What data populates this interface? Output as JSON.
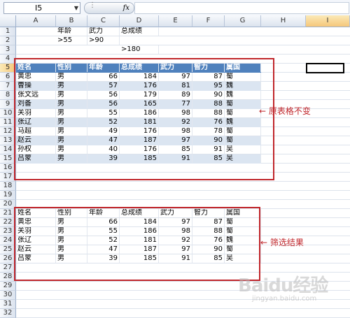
{
  "formula_bar": {
    "name_box": "I5",
    "fx_label": "fx",
    "formula": ""
  },
  "columns": [
    "A",
    "B",
    "C",
    "D",
    "E",
    "F",
    "G",
    "H",
    "I"
  ],
  "active_column": "I",
  "active_row": "5",
  "rows": [
    "1",
    "2",
    "3",
    "4",
    "5",
    "6",
    "7",
    "8",
    "9",
    "10",
    "11",
    "12",
    "13",
    "14",
    "15",
    "16",
    "17",
    "18",
    "19",
    "20",
    "21",
    "22",
    "23",
    "24",
    "25",
    "26",
    "27",
    "28",
    "29",
    "30",
    "31",
    "32"
  ],
  "criteria": {
    "row1": [
      "",
      "年龄",
      "武力",
      "总成绩"
    ],
    "row2": [
      "",
      ">55",
      ">90",
      ""
    ],
    "row3": [
      "",
      "",
      "",
      ">180"
    ]
  },
  "table_headers": [
    "姓名",
    "性别",
    "年龄",
    "总成绩",
    "武力",
    "智力",
    "属国"
  ],
  "table_rows": [
    [
      "黄忠",
      "男",
      "66",
      "184",
      "97",
      "87",
      "蜀"
    ],
    [
      "曹操",
      "男",
      "57",
      "176",
      "81",
      "95",
      "魏"
    ],
    [
      "张文远",
      "男",
      "56",
      "179",
      "89",
      "90",
      "魏"
    ],
    [
      "刘备",
      "男",
      "56",
      "165",
      "77",
      "88",
      "蜀"
    ],
    [
      "关羽",
      "男",
      "55",
      "186",
      "98",
      "88",
      "蜀"
    ],
    [
      "张辽",
      "男",
      "52",
      "181",
      "92",
      "76",
      "魏"
    ],
    [
      "马超",
      "男",
      "49",
      "176",
      "98",
      "78",
      "蜀"
    ],
    [
      "赵云",
      "男",
      "47",
      "187",
      "97",
      "90",
      "蜀"
    ],
    [
      "孙权",
      "男",
      "40",
      "176",
      "85",
      "91",
      "吴"
    ],
    [
      "吕蒙",
      "男",
      "39",
      "185",
      "91",
      "85",
      "吴"
    ]
  ],
  "result_rows": [
    [
      "黄忠",
      "男",
      "66",
      "184",
      "97",
      "87",
      "蜀"
    ],
    [
      "关羽",
      "男",
      "55",
      "186",
      "98",
      "88",
      "蜀"
    ],
    [
      "张辽",
      "男",
      "52",
      "181",
      "92",
      "76",
      "魏"
    ],
    [
      "赵云",
      "男",
      "47",
      "187",
      "97",
      "90",
      "蜀"
    ],
    [
      "吕蒙",
      "男",
      "39",
      "185",
      "91",
      "85",
      "吴"
    ]
  ],
  "annotations": {
    "original_label": "原表格不变",
    "result_label": "筛选结果"
  },
  "watermark": {
    "brand": "Baidu经验",
    "url": "jingyan.baidu.com"
  },
  "colors": {
    "header_band": "#4f81bd",
    "row_band": "#dbe5f1",
    "annotation_red": "#c0262b"
  }
}
